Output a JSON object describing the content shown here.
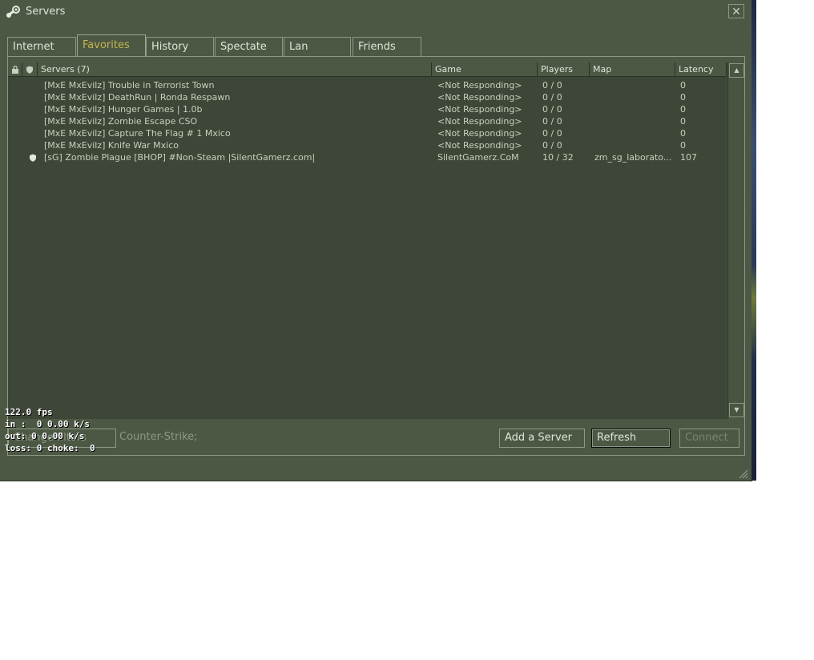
{
  "window": {
    "title": "Servers",
    "close_label": "✕"
  },
  "tabs": [
    {
      "label": "Internet",
      "active": false
    },
    {
      "label": "Favorites",
      "active": true
    },
    {
      "label": "History",
      "active": false
    },
    {
      "label": "Spectate",
      "active": false
    },
    {
      "label": "Lan",
      "active": false
    },
    {
      "label": "Friends",
      "active": false
    }
  ],
  "list": {
    "columns": {
      "lock": "lock-icon",
      "shield": "shield-icon",
      "servers": "Servers (7)",
      "game": "Game",
      "players": "Players",
      "map": "Map",
      "latency": "Latency"
    },
    "rows": [
      {
        "secure": false,
        "name": "[MxE MxEvilz] Trouble in Terrorist Town",
        "game": "<Not Responding>",
        "players": "0 / 0",
        "map": "",
        "latency": "0"
      },
      {
        "secure": false,
        "name": "[MxE MxEvilz] DeathRun | Ronda Respawn",
        "game": "<Not Responding>",
        "players": "0 / 0",
        "map": "",
        "latency": "0"
      },
      {
        "secure": false,
        "name": "[MxE MxEvilz] Hunger Games | 1.0b",
        "game": "<Not Responding>",
        "players": "0 / 0",
        "map": "",
        "latency": "0"
      },
      {
        "secure": false,
        "name": "[MxE MxEvilz] Zombie Escape CSO",
        "game": "<Not Responding>",
        "players": "0 / 0",
        "map": "",
        "latency": "0"
      },
      {
        "secure": false,
        "name": "[MxE MxEvilz] Capture The Flag # 1 Mxico",
        "game": "<Not Responding>",
        "players": "0 / 0",
        "map": "",
        "latency": "0"
      },
      {
        "secure": false,
        "name": "[MxE MxEvilz] Knife War Mxico",
        "game": "<Not Responding>",
        "players": "0 / 0",
        "map": "",
        "latency": "0"
      },
      {
        "secure": true,
        "name": "[sG] Zombie Plague [BHOP] #Non-Steam |SilentGamerz.com|",
        "game": "SilentGamerz.CoM",
        "players": "10 / 32",
        "map": "zm_sg_laborato...",
        "latency": "107"
      }
    ]
  },
  "bottom": {
    "change_filters": "Change filters",
    "filter_summary": "Counter-Strike;",
    "add_server": "Add a Server",
    "refresh": "Refresh",
    "connect": "Connect"
  },
  "hud": {
    "fps": "122.0 fps",
    "in": "in :  0 0.00 k/s",
    "out": "out: 0 0.00 k/s",
    "loss": "loss: 0 choke:  0"
  },
  "colors": {
    "window_bg": "#4c5844",
    "list_bg": "#3e4637",
    "text": "#c8cfbe",
    "active_tab_text": "#c4b550",
    "border": "#8c9884"
  }
}
